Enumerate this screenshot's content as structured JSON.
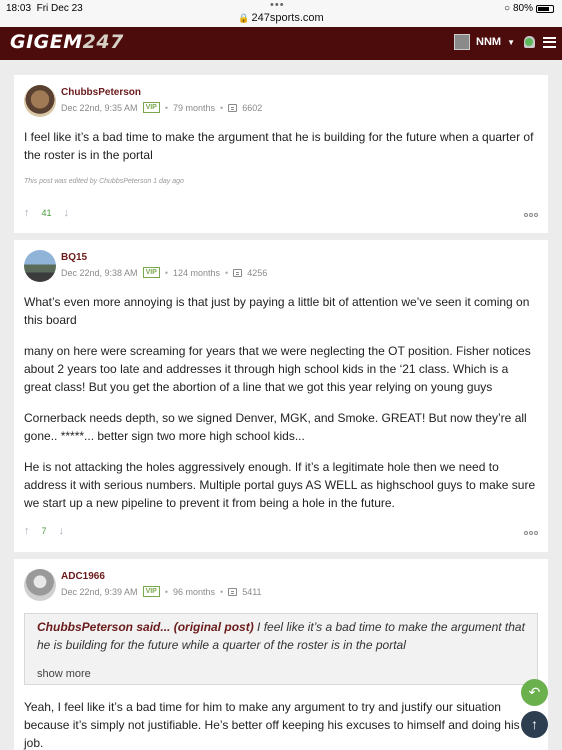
{
  "status_bar": {
    "time": "18:03",
    "date": "Fri Dec 23",
    "url": "247sports.com",
    "battery": "80%"
  },
  "header": {
    "logo_main": "GIGEM",
    "logo_num": "247",
    "user": "NNM"
  },
  "posts": [
    {
      "username": "ChubbsPeterson",
      "date": "Dec 22nd, 9:35 AM",
      "badge": "VIP",
      "tenure": "79 months",
      "post_count": "6602",
      "paragraphs": [
        "I feel like it’s a bad time to make the argument that he is building for the future when a quarter of the roster is in the portal"
      ],
      "edited": "This post was edited by ChubbsPeterson 1 day ago",
      "votes": "41"
    },
    {
      "username": "BQ15",
      "date": "Dec 22nd, 9:38 AM",
      "badge": "VIP",
      "tenure": "124 months",
      "post_count": "4256",
      "paragraphs": [
        "What’s even more annoying is that just by paying a little bit of attention we’ve seen it coming on this board",
        "many on here were screaming for years that we were neglecting the OT position. Fisher notices about 2 years too late and addresses it through high school kids in the ‘21 class. Which is a great class! But you get the abortion of a line that we got this year relying on young guys",
        "Cornerback needs depth, so we signed Denver, MGK, and Smoke. GREAT! But now they’re all gone.. *****... better sign two more high school kids...",
        "He is not attacking the holes aggressively enough. If it’s a legitimate hole then we need to address it with serious numbers. Multiple portal guys AS WELL as highschool guys to make sure we start up a new pipeline to prevent it from being a hole in the future."
      ],
      "votes": "7"
    },
    {
      "username": "ADC1966",
      "date": "Dec 22nd, 9:39 AM",
      "badge": "VIP",
      "tenure": "96 months",
      "post_count": "5411",
      "quote_author": "ChubbsPeterson said... (original post)",
      "quote_text": " I feel like it’s a bad time to make the argument that he is building for the future while a quarter of the roster is in the portal",
      "show_more": "show more",
      "paragraphs": [
        "Yeah, I feel like it’s a bad time for him to make any argument to try and justify our situation because it’s simply not justifiable. He’s better off keeping his excuses to himself and doing his job."
      ]
    }
  ],
  "colors": {
    "header_bg": "#4d0c0c",
    "username": "#6b1b1b",
    "vip": "#79a84c",
    "votes": "#4a9b3e",
    "reply_fab": "#6ab04c",
    "top_fab": "#2c3e50"
  },
  "icons": {
    "reply": "reply-icon",
    "scroll_top": "arrow-up-icon",
    "upvote": "arrow-up-icon",
    "downvote": "arrow-down-icon",
    "more": "more-options-icon"
  }
}
